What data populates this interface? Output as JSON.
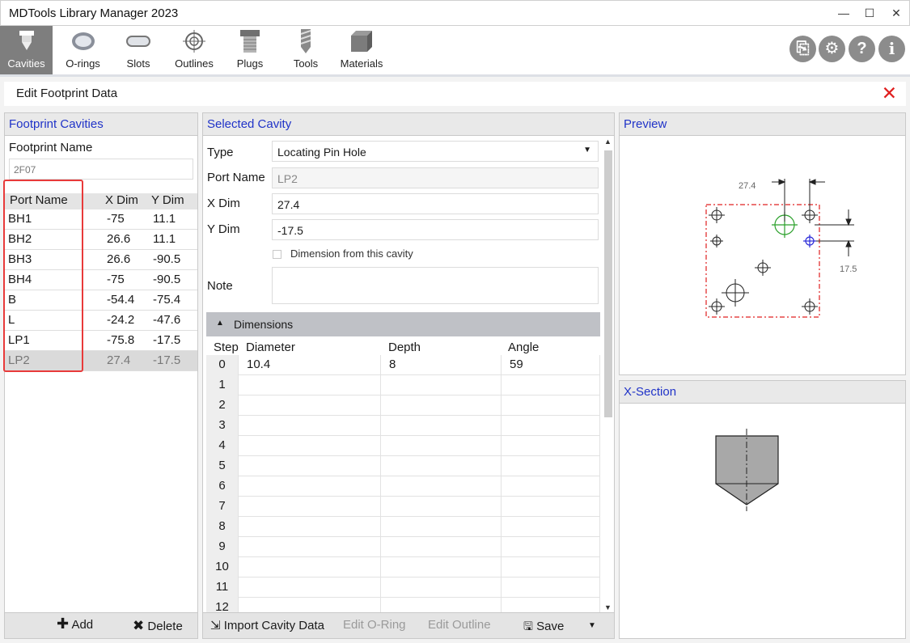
{
  "app": {
    "title": "MDTools Library Manager 2023"
  },
  "window_controls": {
    "minimize": "—",
    "maximize": "☐",
    "close": "✕"
  },
  "ribbon": {
    "tabs": [
      {
        "label": "Cavities",
        "icon": "cavity-icon",
        "active": true
      },
      {
        "label": "O-rings",
        "icon": "oring-icon"
      },
      {
        "label": "Slots",
        "icon": "slot-icon"
      },
      {
        "label": "Outlines",
        "icon": "outline-icon"
      },
      {
        "label": "Plugs",
        "icon": "plug-icon"
      },
      {
        "label": "Tools",
        "icon": "drill-icon"
      },
      {
        "label": "Materials",
        "icon": "material-block-icon"
      }
    ],
    "right_buttons": [
      {
        "icon": "import-file-icon",
        "glyph": "⎘"
      },
      {
        "icon": "gear-icon",
        "glyph": "⚙"
      },
      {
        "icon": "help-icon",
        "glyph": "?"
      },
      {
        "icon": "info-icon",
        "glyph": "i"
      }
    ]
  },
  "editbar": {
    "title": "Edit Footprint Data",
    "close_glyph": "✕"
  },
  "footprint_panel": {
    "header": "Footprint Cavities",
    "name_label": "Footprint Name",
    "name_value": "2F07",
    "columns": [
      "Port Name",
      "X Dim",
      "Y Dim"
    ],
    "rows": [
      {
        "port": "BH1",
        "x": "-75",
        "y": "11.1"
      },
      {
        "port": "BH2",
        "x": "26.6",
        "y": "11.1"
      },
      {
        "port": "BH3",
        "x": "26.6",
        "y": "-90.5"
      },
      {
        "port": "BH4",
        "x": "-75",
        "y": "-90.5"
      },
      {
        "port": "B",
        "x": "-54.4",
        "y": "-75.4"
      },
      {
        "port": "L",
        "x": "-24.2",
        "y": "-47.6"
      },
      {
        "port": "LP1",
        "x": "-75.8",
        "y": "-17.5"
      },
      {
        "port": "LP2",
        "x": "27.4",
        "y": "-17.5"
      }
    ],
    "selected_port": "LP2",
    "add_label": "Add",
    "delete_label": "Delete"
  },
  "cavity_panel": {
    "header": "Selected Cavity",
    "type_label": "Type",
    "type_value": "Locating Pin Hole",
    "port_label": "Port Name",
    "port_value": "LP2",
    "x_label": "X Dim",
    "x_value": "27.4",
    "y_label": "Y Dim",
    "y_value": "-17.5",
    "checkbox_label": "Dimension from this cavity",
    "checkbox_checked": false,
    "note_label": "Note",
    "note_value": "",
    "dimensions_header": "Dimensions",
    "grid_columns": [
      "Step",
      "Diameter",
      "Depth",
      "Angle"
    ],
    "grid_rows": [
      {
        "step": "0",
        "diameter": "10.4",
        "depth": "8",
        "angle": "59"
      },
      {
        "step": "1",
        "diameter": "",
        "depth": "",
        "angle": ""
      },
      {
        "step": "2",
        "diameter": "",
        "depth": "",
        "angle": ""
      },
      {
        "step": "3",
        "diameter": "",
        "depth": "",
        "angle": ""
      },
      {
        "step": "4",
        "diameter": "",
        "depth": "",
        "angle": ""
      },
      {
        "step": "5",
        "diameter": "",
        "depth": "",
        "angle": ""
      },
      {
        "step": "6",
        "diameter": "",
        "depth": "",
        "angle": ""
      },
      {
        "step": "7",
        "diameter": "",
        "depth": "",
        "angle": ""
      },
      {
        "step": "8",
        "diameter": "",
        "depth": "",
        "angle": ""
      },
      {
        "step": "9",
        "diameter": "",
        "depth": "",
        "angle": ""
      },
      {
        "step": "10",
        "diameter": "",
        "depth": "",
        "angle": ""
      },
      {
        "step": "11",
        "diameter": "",
        "depth": "",
        "angle": ""
      },
      {
        "step": "12",
        "diameter": "",
        "depth": "",
        "angle": ""
      }
    ],
    "footer": {
      "import_label": "Import Cavity Data",
      "edit_oring_label": "Edit O-Ring",
      "edit_outline_label": "Edit Outline",
      "save_label": "Save"
    }
  },
  "preview_panel": {
    "header": "Preview",
    "dim_x_label": "27.4",
    "dim_y_label": "17.5"
  },
  "xsection_panel": {
    "header": "X-Section"
  },
  "colors": {
    "header_text": "#2033c8",
    "active_tab": "#7e7e7e",
    "selection_box": "#e83a3a",
    "outline_dash": "#e02020",
    "selected_cavity": "#2ba02b",
    "reference_cavity": "#2b2bd8",
    "close_x": "#e02020"
  }
}
